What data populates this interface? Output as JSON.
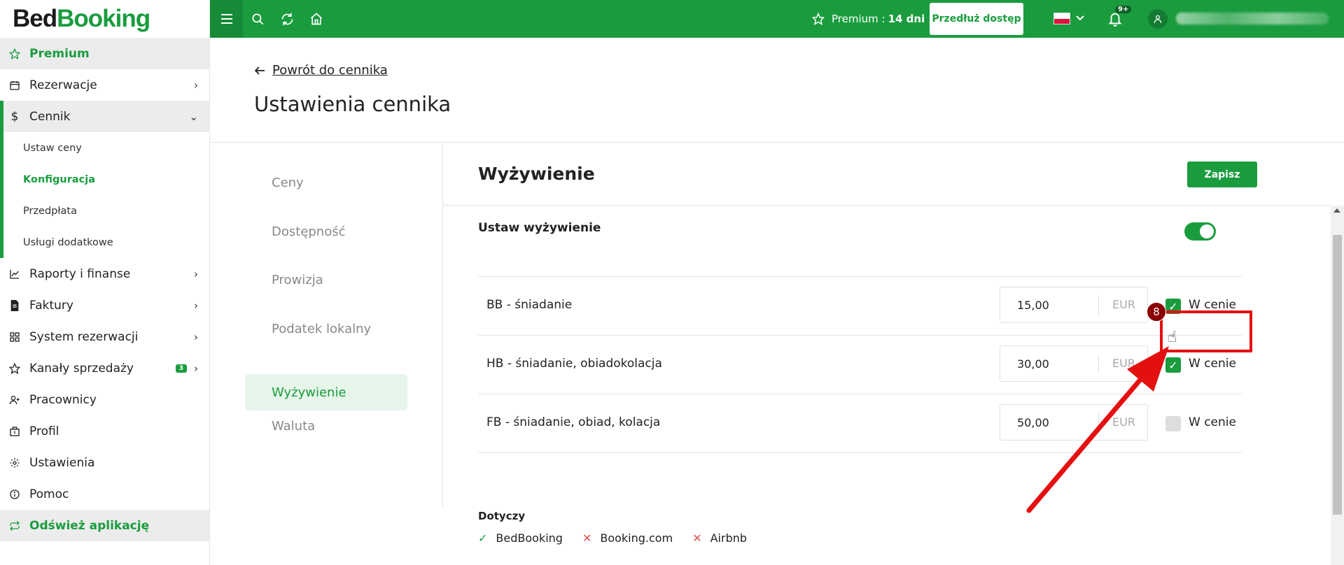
{
  "logo": {
    "part1": "Bed",
    "part2": "Booking"
  },
  "sidebar": {
    "premium": "Premium",
    "items": [
      {
        "label": "Rezerwacje"
      },
      {
        "label": "Cennik"
      },
      {
        "label": "Raporty i finanse"
      },
      {
        "label": "Faktury"
      },
      {
        "label": "System rezerwacji"
      },
      {
        "label": "Kanały sprzedaży",
        "badge": "3"
      },
      {
        "label": "Pracownicy"
      },
      {
        "label": "Profil"
      },
      {
        "label": "Ustawienia"
      },
      {
        "label": "Pomoc"
      }
    ],
    "subitems": [
      "Ustaw ceny",
      "Konfiguracja",
      "Przedpłata",
      "Usługi dodatkowe"
    ],
    "refresh": "Odśwież aplikację"
  },
  "topbar": {
    "premium_label": "Premium :",
    "premium_days": "14 dni",
    "extend_btn": "Przedłuż dostęp",
    "notif_count": "9+"
  },
  "header": {
    "back_label": "Powrót do cennika",
    "title": "Ustawienia cennika"
  },
  "subnav": [
    "Ceny",
    "Dostępność",
    "Prowizja",
    "Podatek lokalny",
    "Wyżywienie",
    "Waluta"
  ],
  "section": {
    "title": "Wyżywienie",
    "save_btn": "Zapisz",
    "toggle_label": "Ustaw wyżywienie",
    "toggle_on": true
  },
  "meals": [
    {
      "name": "BB - śniadanie",
      "price": "15,00",
      "currency": "EUR",
      "in_price": true,
      "in_price_label": "W cenie"
    },
    {
      "name": "HB - śniadanie, obiadokolacja",
      "price": "30,00",
      "currency": "EUR",
      "in_price": true,
      "in_price_label": "W cenie"
    },
    {
      "name": "FB - śniadanie, obiad, kolacja",
      "price": "50,00",
      "currency": "EUR",
      "in_price": false,
      "in_price_label": "W cenie"
    }
  ],
  "applies": {
    "label": "Dotyczy",
    "channels": [
      {
        "name": "BedBooking",
        "enabled": true
      },
      {
        "name": "Booking.com",
        "enabled": false
      },
      {
        "name": "Airbnb",
        "enabled": false
      }
    ]
  },
  "annotation": {
    "step": "8"
  },
  "colors": {
    "brand": "#1a9c3e",
    "annotation": "#e41010"
  }
}
